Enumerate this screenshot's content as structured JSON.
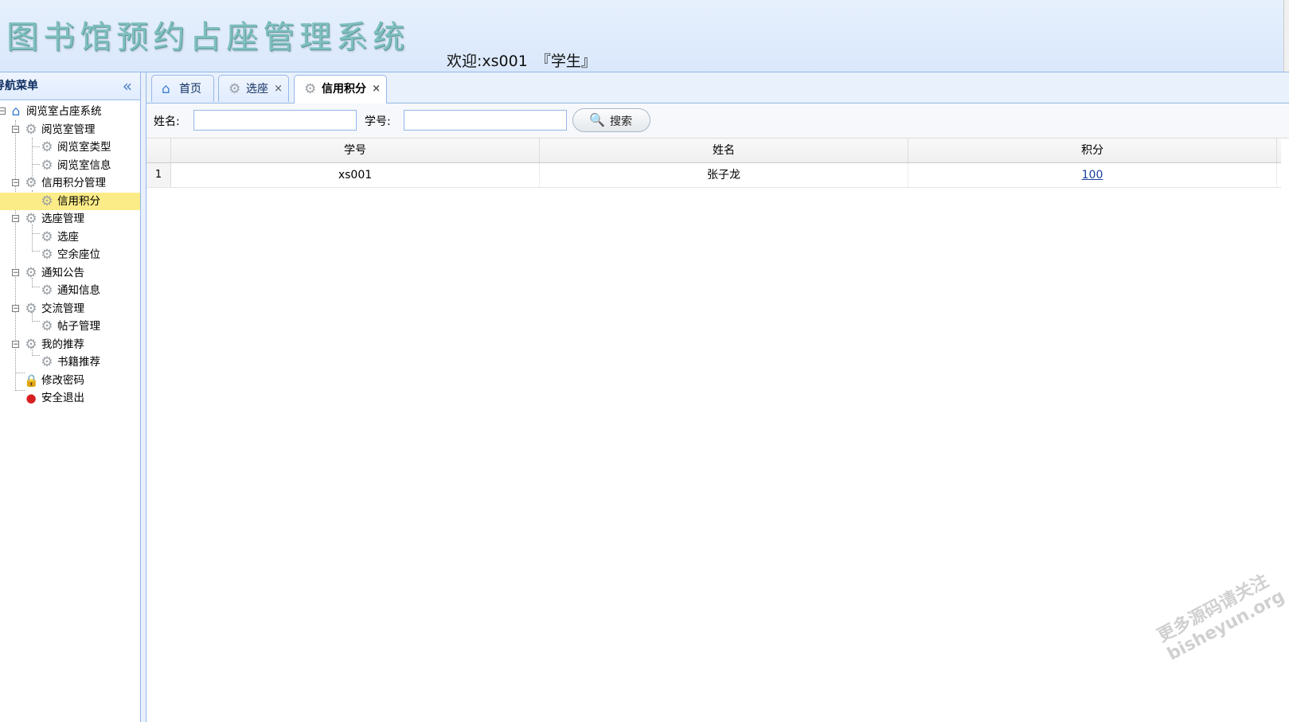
{
  "header": {
    "app_title": "图书馆预约占座管理系统",
    "welcome_label": "欢迎:",
    "username": "xs001",
    "role": "『学生』"
  },
  "sidebar": {
    "title": "导航菜单",
    "collapse_glyph": "«",
    "tree": {
      "root": "阅览室占座系统",
      "groups": [
        {
          "label": "阅览室管理",
          "children": [
            "阅览室类型",
            "阅览室信息"
          ]
        },
        {
          "label": "信用积分管理",
          "children": [
            "信用积分"
          ]
        },
        {
          "label": "选座管理",
          "children": [
            "选座",
            "空余座位"
          ]
        },
        {
          "label": "通知公告",
          "children": [
            "通知信息"
          ]
        },
        {
          "label": "交流管理",
          "children": [
            "帖子管理"
          ]
        },
        {
          "label": "我的推荐",
          "children": [
            "书籍推荐"
          ]
        }
      ],
      "change_password": "修改密码",
      "logout": "安全退出",
      "selected_item": "信用积分"
    }
  },
  "tabs": [
    {
      "label": "首页",
      "icon": "home-icon",
      "closable": false
    },
    {
      "label": "选座",
      "icon": "gear-icon",
      "closable": true
    },
    {
      "label": "信用积分",
      "icon": "gear-icon",
      "closable": true,
      "active": true
    }
  ],
  "toolbar": {
    "name_label": "姓名:",
    "name_value": "",
    "student_id_label": "学号:",
    "student_id_value": "",
    "search_label": "搜索"
  },
  "table": {
    "columns": [
      "学号",
      "姓名",
      "积分"
    ],
    "rows": [
      {
        "index": "1",
        "student_id": "xs001",
        "name": "张子龙",
        "points": "100"
      }
    ]
  },
  "watermark": {
    "line1": "更多源码请关注",
    "line2": "bisheyun.org"
  },
  "colors": {
    "header_bg": "#dae8fc",
    "border": "#95b8e7",
    "selected_row": "#fbec88",
    "title_teal": "#7fbfbf"
  }
}
